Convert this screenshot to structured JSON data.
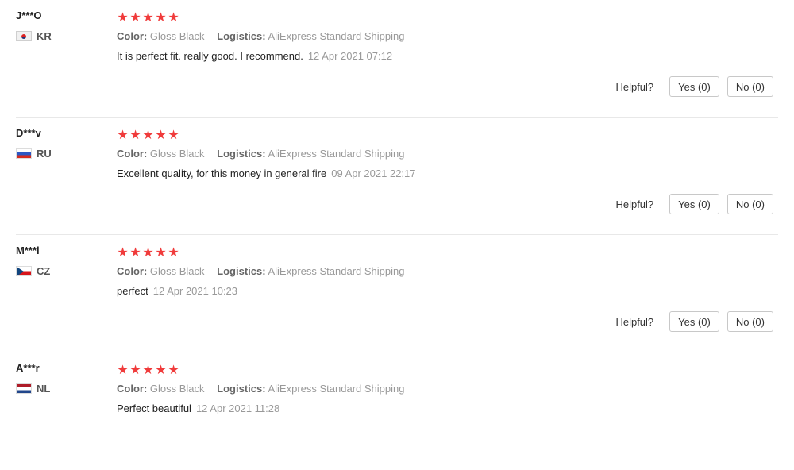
{
  "labels": {
    "color": "Color:",
    "logistics": "Logistics:",
    "helpful": "Helpful?",
    "star": "★"
  },
  "reviews": [
    {
      "user": "J***O",
      "country": "KR",
      "color": "Gloss Black",
      "logistics": "AliExpress Standard Shipping",
      "text": "It is perfect fit. really good. I recommend.",
      "date": "12 Apr 2021 07:12",
      "rating": 5,
      "yes": "Yes (0)",
      "no": "No (0)"
    },
    {
      "user": "D***v",
      "country": "RU",
      "color": "Gloss Black",
      "logistics": "AliExpress Standard Shipping",
      "text": "Excellent quality, for this money in general fire",
      "date": "09 Apr 2021 22:17",
      "rating": 5,
      "yes": "Yes (0)",
      "no": "No (0)"
    },
    {
      "user": "M***l",
      "country": "CZ",
      "color": "Gloss Black",
      "logistics": "AliExpress Standard Shipping",
      "text": "perfect",
      "date": "12 Apr 2021 10:23",
      "rating": 5,
      "yes": "Yes (0)",
      "no": "No (0)"
    },
    {
      "user": "A***r",
      "country": "NL",
      "color": "Gloss Black",
      "logistics": "AliExpress Standard Shipping",
      "text": "Perfect beautiful",
      "date": "12 Apr 2021 11:28",
      "rating": 5
    }
  ],
  "colors": {
    "star": "#f03b3b",
    "divider": "#e8e8e8"
  }
}
